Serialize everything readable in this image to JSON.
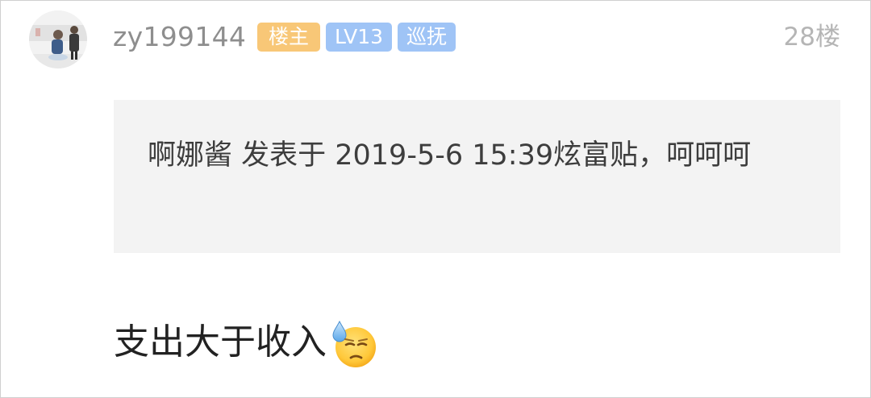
{
  "post": {
    "username": "zy199144",
    "badges": {
      "owner": "楼主",
      "level": "LV13",
      "role": "巡抚"
    },
    "floor": "28楼",
    "quote": {
      "text": "啊娜酱 发表于 2019-5-6 15:39炫富贴，呵呵呵"
    },
    "content": {
      "text": "支出大于收入",
      "emoji": "downcast-sweat-face-icon"
    }
  },
  "colors": {
    "owner_badge": "#f8c777",
    "level_badge": "#9fc4f6",
    "quote_bg": "#f3f3f3",
    "username": "#8e8e8e"
  }
}
